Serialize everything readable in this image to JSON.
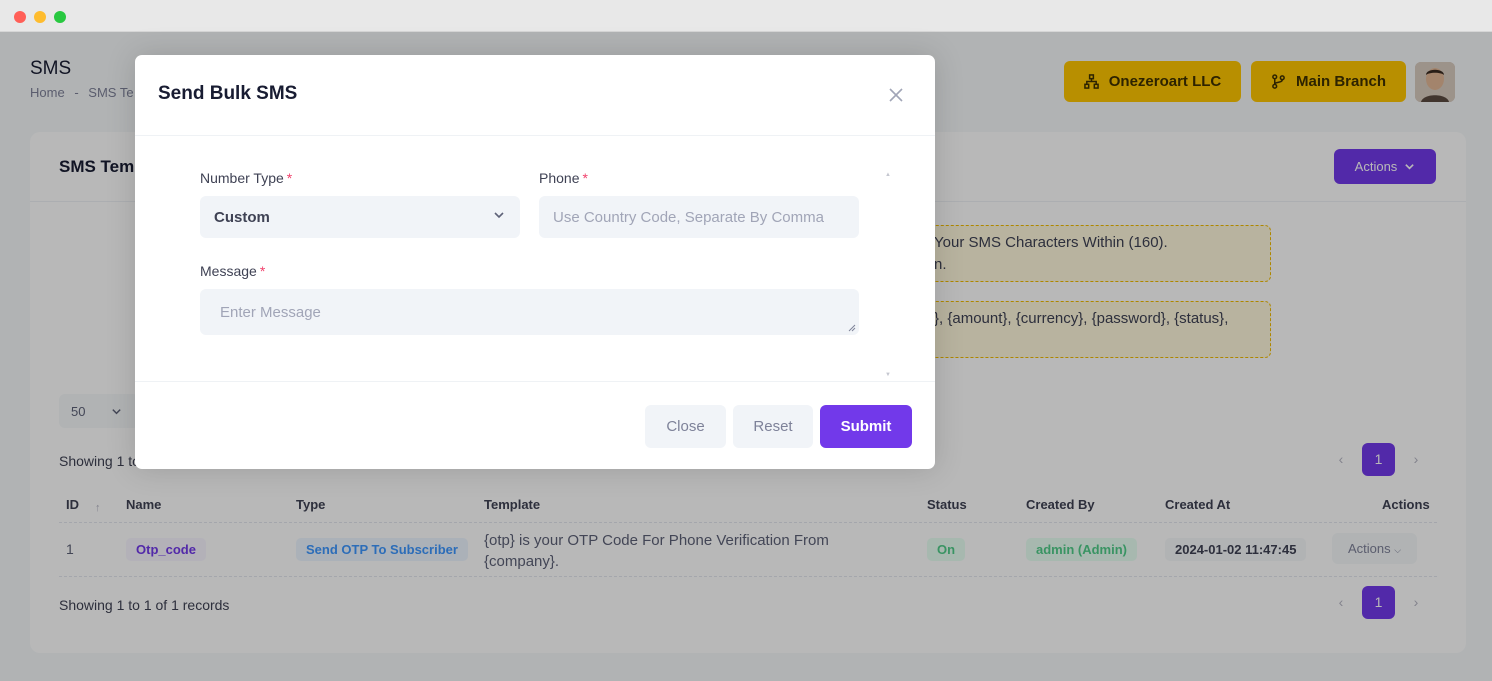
{
  "page": {
    "title": "SMS",
    "breadcrumb": [
      "Home",
      "-",
      "SMS Te"
    ],
    "company_button": "Onezeroart LLC",
    "branch_button": "Main Branch",
    "card_title": "SMS Tem",
    "actions_button": "Actions",
    "notice_1_line_1": "Your SMS Characters Within (160).",
    "notice_1_line_2": "n.",
    "notice_2_line_1": "}, {amount}, {currency}, {password}, {status},",
    "page_size": "50",
    "showing_top": "Showing 1 to",
    "showing_bottom": "Showing 1 to 1 of 1 records",
    "current_page": "1",
    "table": {
      "headers": [
        "ID",
        "Name",
        "Type",
        "Template",
        "Status",
        "Created By",
        "Created At",
        "Actions"
      ],
      "rows": [
        {
          "id": "1",
          "name": "Otp_code",
          "type": "Send OTP To Subscriber",
          "template_line_1": "{otp} is your OTP Code For Phone Verification From",
          "template_line_2": "{company}.",
          "status": "On",
          "created_by": "admin (Admin)",
          "created_at": "2024-01-02 11:47:45",
          "actions": "Actions"
        }
      ]
    }
  },
  "modal": {
    "title": "Send Bulk SMS",
    "number_type_label": "Number Type",
    "number_type_value": "Custom",
    "phone_label": "Phone",
    "phone_placeholder": "Use Country Code, Separate By Comma",
    "message_label": "Message",
    "message_placeholder": "Enter Message",
    "required_mark": "*",
    "close_label": "Close",
    "reset_label": "Reset",
    "submit_label": "Submit"
  },
  "colors": {
    "accent": "#7239ea",
    "warning": "#ffc700",
    "danger": "#f1416c",
    "success": "#50cd89",
    "info": "#3e97ff"
  }
}
